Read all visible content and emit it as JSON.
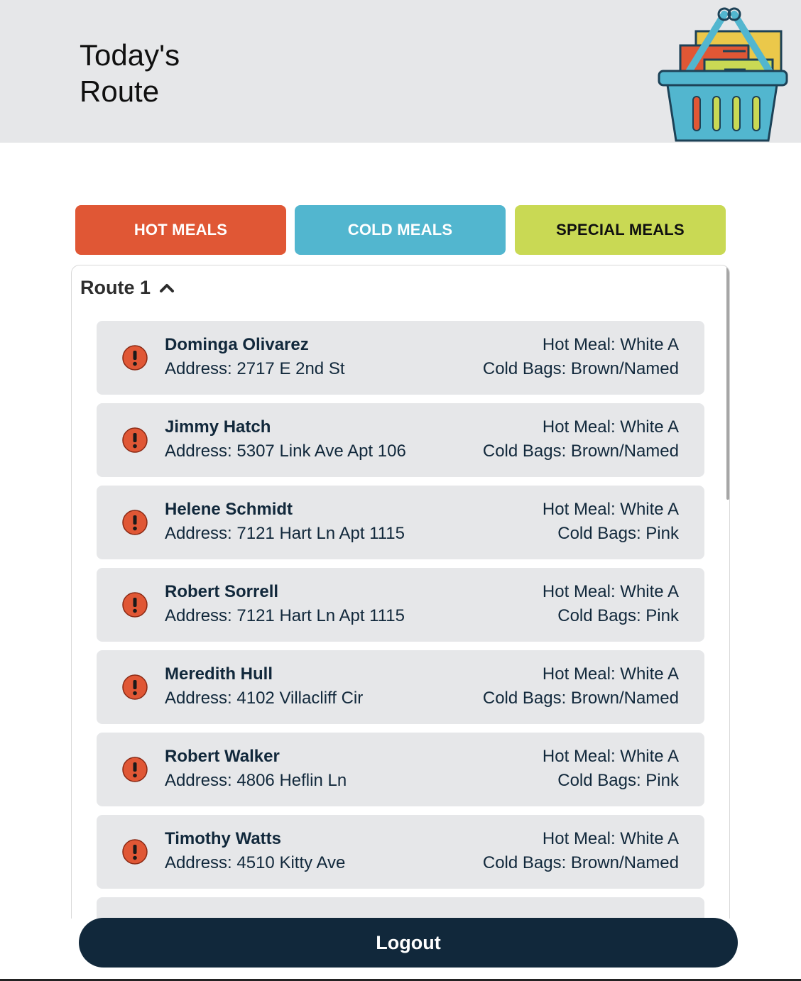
{
  "header": {
    "title": "Today's Route"
  },
  "tabs": [
    {
      "label": "HOT MEALS",
      "color": "#e05735"
    },
    {
      "label": "COLD MEALS",
      "color": "#52b6cf"
    },
    {
      "label": "SPECIAL MEALS",
      "color": "#c9d954"
    }
  ],
  "route": {
    "title": "Route 1",
    "deliveries": [
      {
        "name": "Dominga Olivarez",
        "address": "Address: 2717 E 2nd St",
        "hot_meal": "Hot Meal: White A",
        "cold_bags": "Cold Bags: Brown/Named"
      },
      {
        "name": "Jimmy Hatch",
        "address": "Address: 5307 Link Ave Apt 106",
        "hot_meal": "Hot Meal: White A",
        "cold_bags": "Cold Bags: Brown/Named"
      },
      {
        "name": "Helene Schmidt",
        "address": "Address: 7121 Hart Ln Apt 1115",
        "hot_meal": "Hot Meal: White A",
        "cold_bags": "Cold Bags: Pink"
      },
      {
        "name": "Robert Sorrell",
        "address": "Address: 7121 Hart Ln Apt 1115",
        "hot_meal": "Hot Meal: White A",
        "cold_bags": "Cold Bags: Pink"
      },
      {
        "name": "Meredith Hull",
        "address": "Address: 4102 Villacliff Cir",
        "hot_meal": "Hot Meal: White A",
        "cold_bags": "Cold Bags: Brown/Named"
      },
      {
        "name": "Robert Walker",
        "address": "Address: 4806 Heflin Ln",
        "hot_meal": "Hot Meal: White A",
        "cold_bags": "Cold Bags: Pink"
      },
      {
        "name": "Timothy Watts",
        "address": "Address: 4510 Kitty Ave",
        "hot_meal": "Hot Meal: White A",
        "cold_bags": "Cold Bags: Brown/Named"
      }
    ]
  },
  "footer": {
    "logout_label": "Logout"
  },
  "colors": {
    "navy": "#11283b",
    "alert": "#e05735",
    "row_bg": "#e6e7e9"
  },
  "icons": {
    "logo": "shopping-basket-icon",
    "alert": "exclamation-circle-icon",
    "toggle": "chevron-up-icon"
  }
}
